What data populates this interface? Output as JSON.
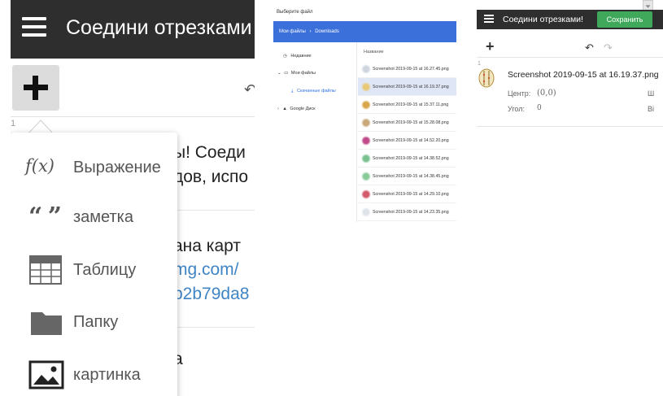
{
  "panel1": {
    "header_title": "Соедини отрезками",
    "row_number": "1",
    "text_lines": [
      "ы! Соеди",
      "дов, испо"
    ],
    "map_line": "ана карт",
    "link_lines": [
      "mg.com/",
      "b2b79da8"
    ],
    "bottom_text": "а",
    "menu": [
      {
        "icon": "function-icon",
        "label": "Выражение"
      },
      {
        "icon": "quote-icon",
        "label": "заметка"
      },
      {
        "icon": "table-icon",
        "label": "Таблицу"
      },
      {
        "icon": "folder-icon",
        "label": "Папку"
      },
      {
        "icon": "image-icon",
        "label": "картинка"
      }
    ],
    "function_glyph": "f(x)",
    "quote_glyph": "“ ”"
  },
  "panel2": {
    "dialog_title": "Выберите файл",
    "breadcrumb": [
      "Мои файлы",
      "Downloads"
    ],
    "breadcrumb_sep": "›",
    "nav": {
      "recent": "Недавние",
      "my_files": "Мои файлы",
      "downloads": "Скачанные файлы",
      "google_drive": "Google Диск"
    },
    "column_header": "Название",
    "files": [
      "Screenshot 2019-09-15 at 16.27.45.png",
      "Screenshot 2019-09-15 at 16.19.37.png",
      "Screenshot 2019-09-15 at 15.37.11.png",
      "Screenshot 2019-09-15 at 15.28.08.png",
      "Screenshot 2019-09-15 at 14.52.20.png",
      "Screenshot 2019-09-15 at 14.38.52.png",
      "Screenshot 2019-09-15 at 14.38.45.png",
      "Screenshot 2019-09-15 at 14.29.10.png",
      "Screenshot 2019-09-15 at 14.23.35.png"
    ],
    "selected_index": 1
  },
  "panel3": {
    "header_title": "Соедини отрезками!",
    "save_label": "Сохранить",
    "row_number": "1",
    "item_name": "Screenshot 2019-09-15 at 16.19.37.png",
    "center_label": "Центр:",
    "center_value": "(0,0)",
    "angle_label": "Угол:",
    "angle_value": "0",
    "right_label_1": "Ш",
    "right_label_2": "Ві"
  },
  "colors": {
    "header_dark": "#2e2e2e",
    "drive_blue": "#3b6fd9",
    "save_green": "#3fa85b",
    "link_blue": "#3f84c4"
  }
}
